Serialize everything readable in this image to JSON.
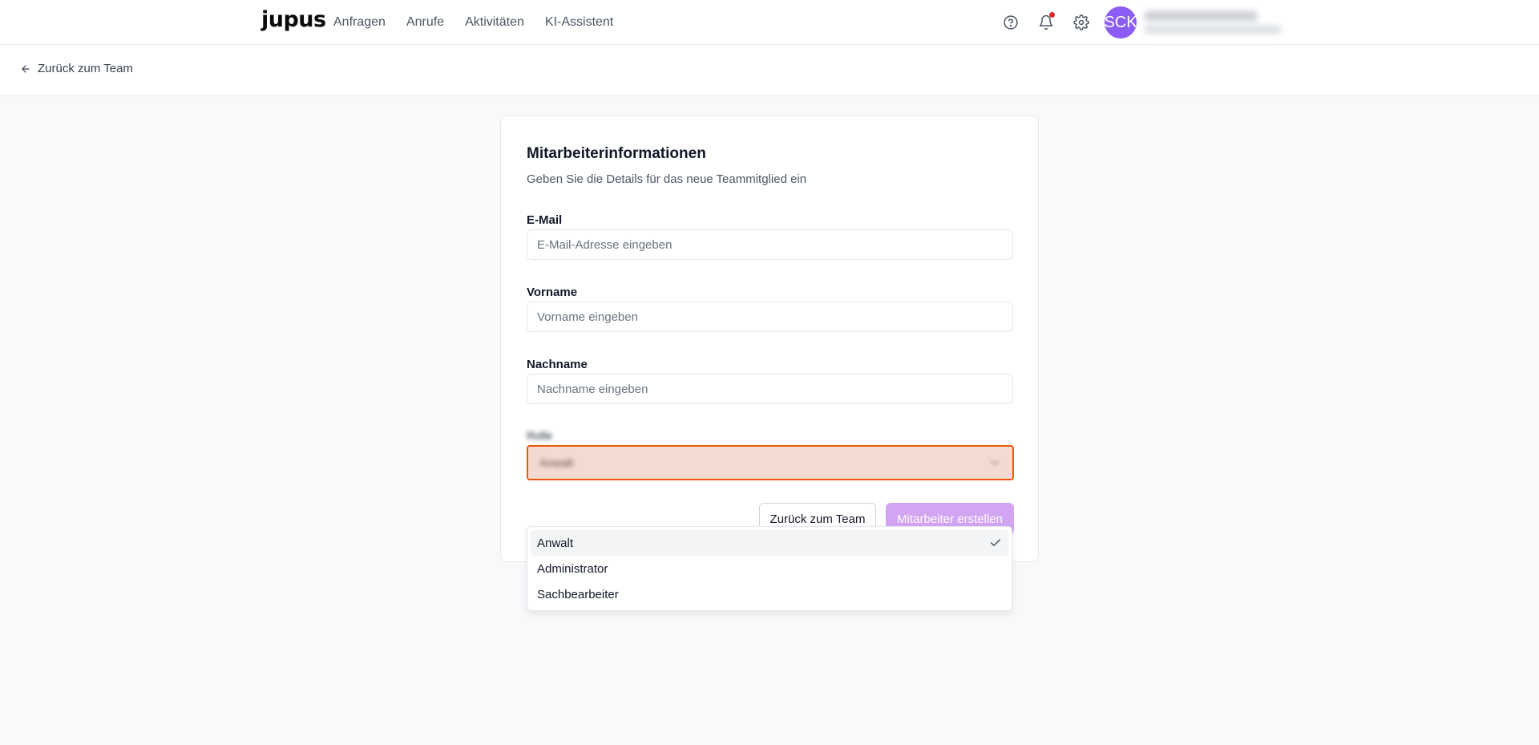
{
  "brand": {
    "logo_text": "jupus"
  },
  "nav": {
    "items": [
      "Anfragen",
      "Anrufe",
      "Aktivitäten",
      "KI-Assistent"
    ]
  },
  "user": {
    "initials": "SCK",
    "avatar_color": "#8b5cf6"
  },
  "subheader": {
    "back_label": "Zurück zum Team"
  },
  "form": {
    "title": "Mitarbeiterinformationen",
    "description": "Geben Sie die Details für das neue Teammitglied ein",
    "email": {
      "label": "E-Mail",
      "placeholder": "E-Mail-Adresse eingeben",
      "value": ""
    },
    "first_name": {
      "label": "Vorname",
      "placeholder": "Vorname eingeben",
      "value": ""
    },
    "last_name": {
      "label": "Nachname",
      "placeholder": "Nachname eingeben",
      "value": ""
    },
    "role": {
      "label": "Rolle",
      "selected": "Anwalt"
    },
    "cancel_label": "Zurück zum Team",
    "submit_label": "Mitarbeiter erstellen"
  },
  "role_options": [
    {
      "label": "Anwalt",
      "selected": true
    },
    {
      "label": "Administrator",
      "selected": false
    },
    {
      "label": "Sachbearbeiter",
      "selected": false
    }
  ],
  "colors": {
    "accent": "#d2a4f2",
    "focus_ring": "#ea580c",
    "notification": "#dc2626"
  }
}
